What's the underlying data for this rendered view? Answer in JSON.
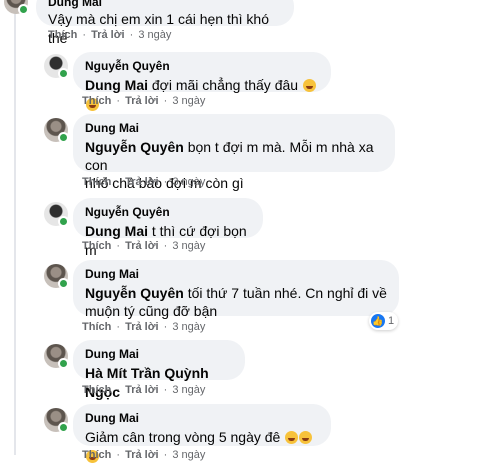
{
  "top_comment": {
    "author": "Dung Mai",
    "text": "Vậy mà chị em xin 1 cái hẹn thì khó thế",
    "like_label": "Thích",
    "reply_label": "Trả lời",
    "time": "3 ngày"
  },
  "replies": [
    {
      "author": "Nguyễn Quyên",
      "mention": "Dung Mai",
      "text": "đợi mãi chẳng thấy đâu",
      "like_label": "Thích",
      "reply_label": "Trả lời",
      "time": "3 ngày"
    },
    {
      "author": "Dung Mai",
      "mention": "Nguyễn Quyên",
      "text_line1": "bọn t đợi m mà. Mỗi m nhà xa con",
      "text_line2": "nhỏ chả bảo đợi m còn gì",
      "like_label": "Thích",
      "reply_label": "Trả lời",
      "time": "3 ngày"
    },
    {
      "author": "Nguyễn Quyên",
      "mention": "Dung Mai",
      "text": "t thì cứ đợi bọn m",
      "like_label": "Thích",
      "reply_label": "Trả lời",
      "time": "3 ngày"
    },
    {
      "author": "Dung Mai",
      "mention": "Nguyễn Quyên",
      "text_line1": "tối thứ 7 tuần nhé. Cn nghỉ đi về",
      "text_line2": "muộn tý cũng đỡ bận",
      "like_label": "Thích",
      "reply_label": "Trả lời",
      "time": "3 ngày",
      "reaction_count": "1"
    },
    {
      "author": "Dung Mai",
      "text": "Hà Mít Trần Quỳnh Ngọc",
      "like_label": "Thích",
      "reply_label": "Trả lời",
      "time": "3 ngày"
    },
    {
      "author": "Dung Mai",
      "text": "Giảm cân trong vòng 5 ngày đê",
      "like_label": "Thích",
      "reply_label": "Trả lời",
      "time": "3 ngày"
    }
  ]
}
